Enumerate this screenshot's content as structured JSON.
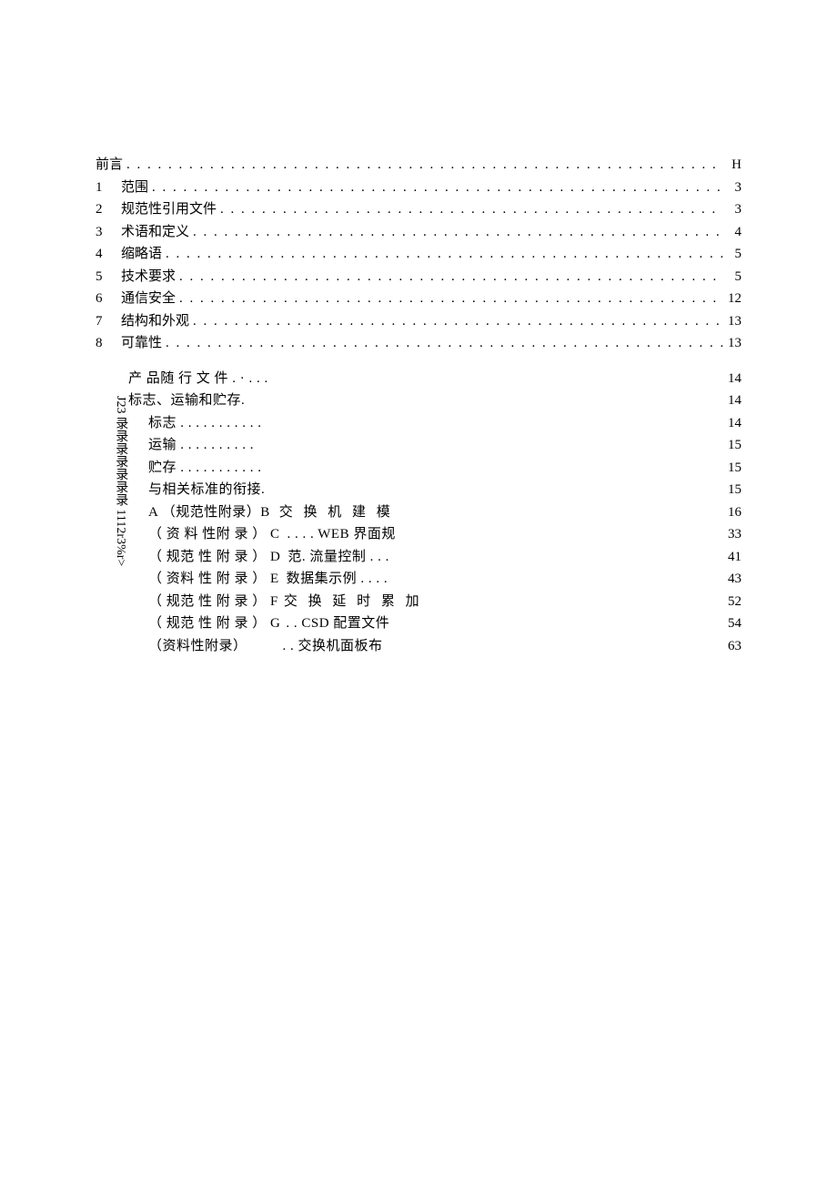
{
  "toc_main": [
    {
      "num": "",
      "label": "前言",
      "page": "H"
    },
    {
      "num": "1",
      "label": "范围",
      "page": "3"
    },
    {
      "num": "2",
      "label": "规范性引用文件",
      "page": "3"
    },
    {
      "num": "3",
      "label": "术语和定义",
      "page": "4"
    },
    {
      "num": "4",
      "label": "缩略语",
      "page": "5"
    },
    {
      "num": "5",
      "label": "技术要求",
      "page": "5"
    },
    {
      "num": "6",
      "label": "通信安全",
      "page": "12"
    },
    {
      "num": "7",
      "label": "结构和外观",
      "page": "13"
    },
    {
      "num": "8",
      "label": "可靠性",
      "page": "13"
    }
  ],
  "vertical_text": "J23 录录录录录录录 1112r3%r>",
  "toc_sub": [
    {
      "indent": 1,
      "label": "产 品随 行 文 件 . · . . .",
      "page": "14"
    },
    {
      "indent": 1,
      "label": "标志、运输和贮存.",
      "page": "14"
    },
    {
      "indent": 2,
      "label": "标志 . . . . . . . . . . .",
      "page": "14"
    },
    {
      "indent": 2,
      "label": "运输 . . . . . . . . . .",
      "page": "15"
    },
    {
      "indent": 2,
      "label": "贮存 . . . . . . . . . . .",
      "page": "15"
    },
    {
      "indent": 2,
      "label": "与相关标准的衔接.",
      "page": "15"
    },
    {
      "indent": 2,
      "label": "A （规范性附录）B",
      "tail": "交 换 机 建 模",
      "page": "16"
    },
    {
      "indent": 2,
      "label": "（ 资 料 性附 录 ） C",
      "tail": " . . . . WEB 界面规",
      "page": "33"
    },
    {
      "indent": 2,
      "label": "（ 规范 性 附 录 ） D",
      "tail": "范. 流量控制 . . .",
      "page": "41"
    },
    {
      "indent": 2,
      "label": "（ 资料 性 附 录 ） E",
      "tail": " 数据集示例 . . . .",
      "page": "43"
    },
    {
      "indent": 2,
      "label": "（ 规范 性 附 录 ） F",
      "tail": "交 换 延 时 累 加",
      "page": "52"
    },
    {
      "indent": 2,
      "label": "（ 规范 性 附 录 ） G",
      "tail": " . . CSD 配置文件",
      "page": "54"
    },
    {
      "indent": 2,
      "label": "（资料性附录）",
      "tail": "    . . 交换机面板布",
      "page": "63"
    }
  ],
  "dots": ". . . . . . . . . . . . . . . . . . . . . . . . . . . . . . . . . . . . . . . . . . . . . . . . . . . . . . . . . . . . . . . . . . . . . . . . . . . . . . . . . . . . . . . . . . . . . . . . . . . . . . . . . . . . . ."
}
